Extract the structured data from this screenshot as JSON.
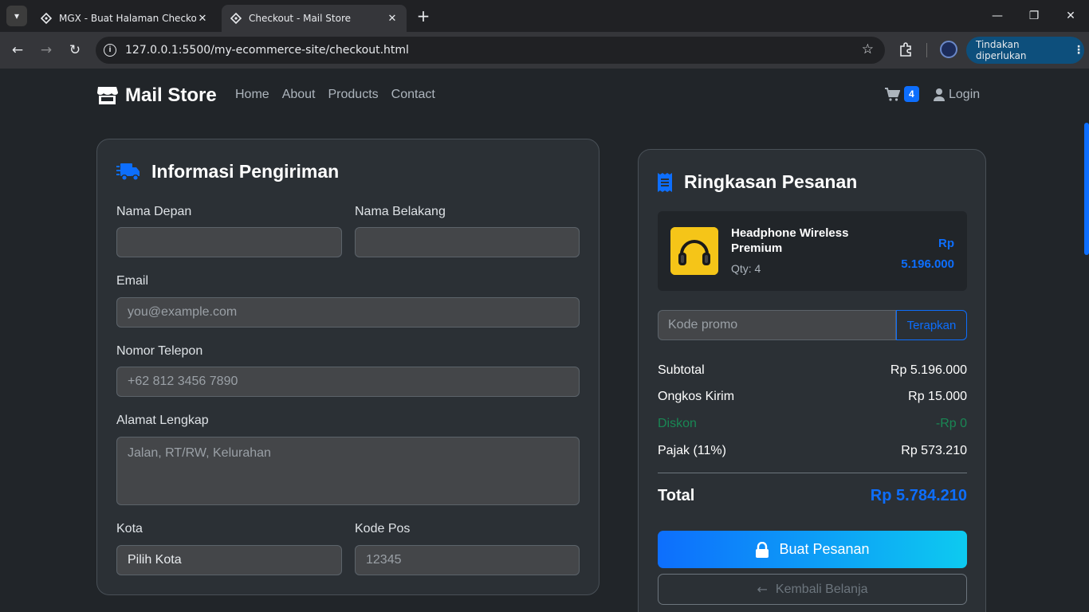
{
  "browser": {
    "tabs": [
      {
        "title": "MGX - Buat Halaman Checkout",
        "active": false
      },
      {
        "title": "Checkout - Mail Store",
        "active": true
      }
    ],
    "new_tab_label": "+",
    "url": "127.0.0.1:5500/my-ecommerce-site/checkout.html",
    "action_label": "Tindakan diperlukan"
  },
  "header": {
    "brand": "Mail Store",
    "nav": [
      "Home",
      "About",
      "Products",
      "Contact"
    ],
    "cart_count": "4",
    "login": "Login"
  },
  "shipping": {
    "title": "Informasi Pengiriman",
    "first_name_label": "Nama Depan",
    "first_name_value": "",
    "last_name_label": "Nama Belakang",
    "last_name_value": "",
    "email_label": "Email",
    "email_placeholder": "you@example.com",
    "phone_label": "Nomor Telepon",
    "phone_placeholder": "+62 812 3456 7890",
    "address_label": "Alamat Lengkap",
    "address_placeholder": "Jalan, RT/RW, Kelurahan",
    "city_label": "Kota",
    "city_value": "Pilih Kota",
    "postal_label": "Kode Pos",
    "postal_placeholder": "12345"
  },
  "summary": {
    "title": "Ringkasan Pesanan",
    "item": {
      "name": "Headphone Wireless Premium",
      "qty": "Qty: 4",
      "price_currency": "Rp",
      "price_amount": "5.196.000"
    },
    "promo_placeholder": "Kode promo",
    "promo_button": "Terapkan",
    "rows": [
      {
        "label": "Subtotal",
        "value": "Rp 5.196.000"
      },
      {
        "label": "Ongkos Kirim",
        "value": "Rp 15.000"
      },
      {
        "label": "Diskon",
        "value": "-Rp 0"
      },
      {
        "label": "Pajak (11%)",
        "value": "Rp 573.210"
      }
    ],
    "total_label": "Total",
    "total_value": "Rp 5.784.210",
    "order_button": "Buat Pesanan",
    "back_button": "Kembali Belanja"
  },
  "colors": {
    "accent": "#0d6efd",
    "discount": "#198754",
    "card_bg": "#2b3035"
  },
  "icons": [
    "store-icon",
    "shopping-cart-icon",
    "user-icon",
    "truck-fast-icon",
    "receipt-icon",
    "lock-icon",
    "arrow-left-icon"
  ]
}
